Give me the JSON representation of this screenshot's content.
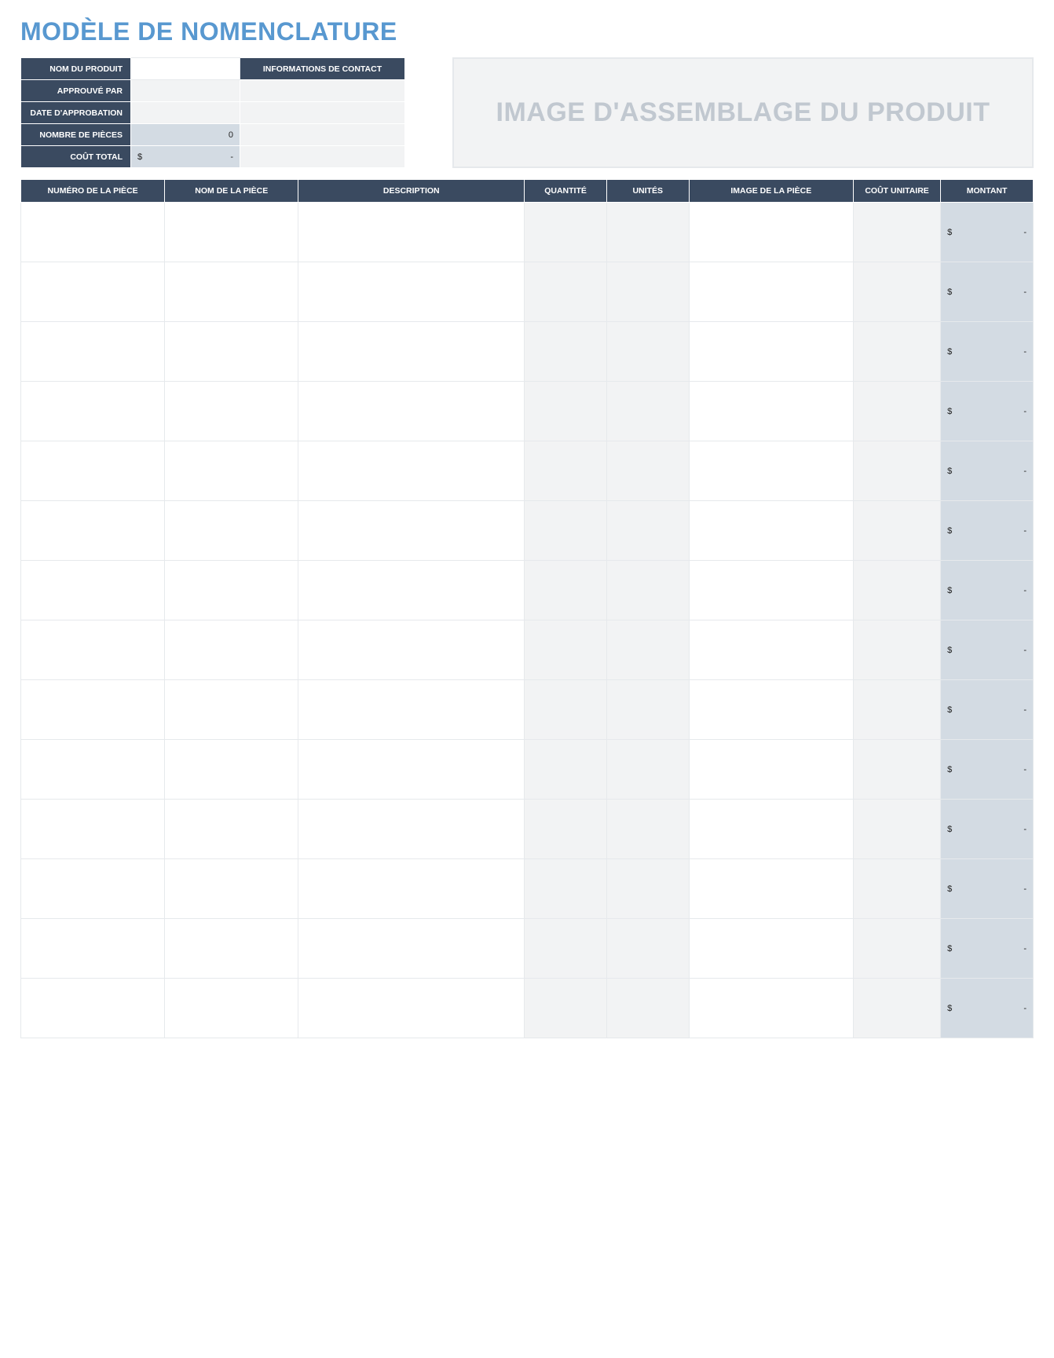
{
  "title": "MODÈLE DE NOMENCLATURE",
  "info": {
    "labels": {
      "product_name": "NOM DU PRODUIT",
      "approved_by": "APPROUVÉ PAR",
      "approval_date": "DATE D'APPROBATION",
      "part_count": "NOMBRE DE PIÈCES",
      "total_cost": "COÛT TOTAL",
      "contact_info": "INFORMATIONS DE CONTACT"
    },
    "values": {
      "product_name": "",
      "approved_by": "",
      "approval_date": "",
      "part_count": "0",
      "total_cost_currency": "$",
      "total_cost_value": "-",
      "contact_1": "",
      "contact_2": "",
      "contact_3": "",
      "contact_4": ""
    }
  },
  "image_placeholder": "IMAGE D'ASSEMBLAGE DU PRODUIT",
  "columns": {
    "part_number": "NUMÉRO DE LA PIÈCE",
    "part_name": "NOM DE LA PIÈCE",
    "description": "DESCRIPTION",
    "quantity": "QUANTITÉ",
    "units": "UNITÉS",
    "part_image": "IMAGE DE LA PIÈCE",
    "unit_cost": "COÛT UNITAIRE",
    "amount": "MONTANT"
  },
  "rows": [
    {
      "part_number": "",
      "part_name": "",
      "description": "",
      "quantity": "",
      "units": "",
      "part_image": "",
      "unit_cost": "",
      "amount_currency": "$",
      "amount_value": "-"
    },
    {
      "part_number": "",
      "part_name": "",
      "description": "",
      "quantity": "",
      "units": "",
      "part_image": "",
      "unit_cost": "",
      "amount_currency": "$",
      "amount_value": "-"
    },
    {
      "part_number": "",
      "part_name": "",
      "description": "",
      "quantity": "",
      "units": "",
      "part_image": "",
      "unit_cost": "",
      "amount_currency": "$",
      "amount_value": "-"
    },
    {
      "part_number": "",
      "part_name": "",
      "description": "",
      "quantity": "",
      "units": "",
      "part_image": "",
      "unit_cost": "",
      "amount_currency": "$",
      "amount_value": "-"
    },
    {
      "part_number": "",
      "part_name": "",
      "description": "",
      "quantity": "",
      "units": "",
      "part_image": "",
      "unit_cost": "",
      "amount_currency": "$",
      "amount_value": "-"
    },
    {
      "part_number": "",
      "part_name": "",
      "description": "",
      "quantity": "",
      "units": "",
      "part_image": "",
      "unit_cost": "",
      "amount_currency": "$",
      "amount_value": "-"
    },
    {
      "part_number": "",
      "part_name": "",
      "description": "",
      "quantity": "",
      "units": "",
      "part_image": "",
      "unit_cost": "",
      "amount_currency": "$",
      "amount_value": "-"
    },
    {
      "part_number": "",
      "part_name": "",
      "description": "",
      "quantity": "",
      "units": "",
      "part_image": "",
      "unit_cost": "",
      "amount_currency": "$",
      "amount_value": "-"
    },
    {
      "part_number": "",
      "part_name": "",
      "description": "",
      "quantity": "",
      "units": "",
      "part_image": "",
      "unit_cost": "",
      "amount_currency": "$",
      "amount_value": "-"
    },
    {
      "part_number": "",
      "part_name": "",
      "description": "",
      "quantity": "",
      "units": "",
      "part_image": "",
      "unit_cost": "",
      "amount_currency": "$",
      "amount_value": "-"
    },
    {
      "part_number": "",
      "part_name": "",
      "description": "",
      "quantity": "",
      "units": "",
      "part_image": "",
      "unit_cost": "",
      "amount_currency": "$",
      "amount_value": "-"
    },
    {
      "part_number": "",
      "part_name": "",
      "description": "",
      "quantity": "",
      "units": "",
      "part_image": "",
      "unit_cost": "",
      "amount_currency": "$",
      "amount_value": "-"
    },
    {
      "part_number": "",
      "part_name": "",
      "description": "",
      "quantity": "",
      "units": "",
      "part_image": "",
      "unit_cost": "",
      "amount_currency": "$",
      "amount_value": "-"
    },
    {
      "part_number": "",
      "part_name": "",
      "description": "",
      "quantity": "",
      "units": "",
      "part_image": "",
      "unit_cost": "",
      "amount_currency": "$",
      "amount_value": "-"
    }
  ]
}
